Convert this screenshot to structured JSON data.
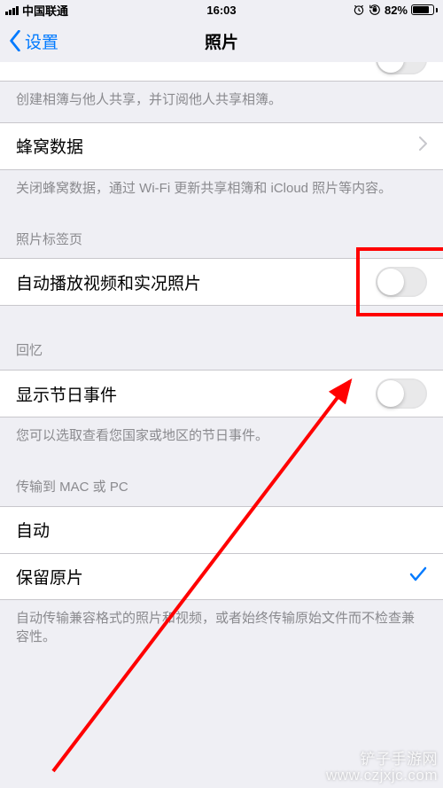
{
  "status": {
    "carrier": "中国联通",
    "time": "16:03",
    "battery_pct": "82%",
    "alarm_icon": "⏰",
    "lock_icon": "🔒"
  },
  "nav": {
    "back_label": "设置",
    "title": "照片"
  },
  "shared_albums": {
    "footer": "创建相簿与他人共享，并订阅他人共享相簿。"
  },
  "cellular": {
    "label": "蜂窝数据",
    "footer": "关闭蜂窝数据，通过 Wi-Fi 更新共享相簿和 iCloud 照片等内容。"
  },
  "photos_tab": {
    "header": "照片标签页",
    "autoplay_label": "自动播放视频和实况照片",
    "autoplay_on": false
  },
  "memories": {
    "header": "回忆",
    "holiday_label": "显示节日事件",
    "holiday_on": false,
    "footer": "您可以选取查看您国家或地区的节日事件。"
  },
  "transfer": {
    "header": "传输到 MAC 或 PC",
    "auto_label": "自动",
    "keep_label": "保留原片",
    "selected": "keep",
    "footer": "自动传输兼容格式的照片和视频，或者始终传输原始文件而不检查兼容性。"
  },
  "watermark": "铲子手游网\nwww.czjxjc.com"
}
